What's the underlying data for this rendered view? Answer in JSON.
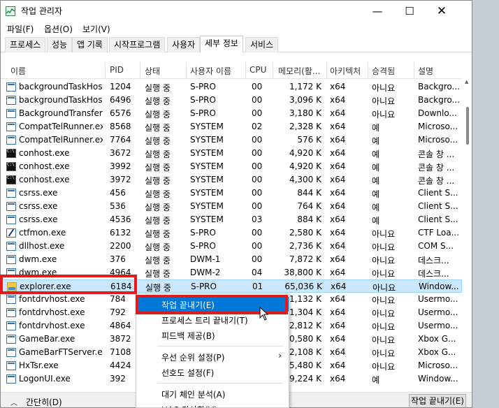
{
  "window": {
    "title": "작업 관리자"
  },
  "menu": [
    "파일(F)",
    "옵션(O)",
    "보기(V)"
  ],
  "tabs": [
    "프로세스",
    "성능",
    "앱 기록",
    "시작프로그램",
    "사용자",
    "세부 정보",
    "서비스"
  ],
  "active_tab": "세부 정보",
  "columns": [
    "이름",
    "PID",
    "상태",
    "사용자 이름",
    "CPU",
    "메모리(활...",
    "아키텍처",
    "승격됨",
    "설명"
  ],
  "rows": [
    {
      "icon": "app",
      "name": "backgroundTaskHos...",
      "pid": "1204",
      "status": "실행 중",
      "user": "S-PRO",
      "cpu": "00",
      "mem": "1,172 K",
      "arch": "x64",
      "elev": "아니요",
      "desc": "Backgro..."
    },
    {
      "icon": "app",
      "name": "backgroundTaskHos...",
      "pid": "6496",
      "status": "실행 중",
      "user": "S-PRO",
      "cpu": "00",
      "mem": "3,096 K",
      "arch": "x64",
      "elev": "아니요",
      "desc": "Backgro..."
    },
    {
      "icon": "app",
      "name": "BackgroundTransfer...",
      "pid": "6576",
      "status": "실행 중",
      "user": "S-PRO",
      "cpu": "00",
      "mem": "3,180 K",
      "arch": "x64",
      "elev": "아니요",
      "desc": "Downlo..."
    },
    {
      "icon": "app",
      "name": "CompatTelRunner.exe",
      "pid": "8568",
      "status": "실행 중",
      "user": "SYSTEM",
      "cpu": "02",
      "mem": "2,328 K",
      "arch": "x64",
      "elev": "예",
      "desc": "Microso..."
    },
    {
      "icon": "app",
      "name": "CompatTelRunner.exe",
      "pid": "7764",
      "status": "실행 중",
      "user": "SYSTEM",
      "cpu": "00",
      "mem": "576 K",
      "arch": "x64",
      "elev": "예",
      "desc": "Microso..."
    },
    {
      "icon": "con",
      "name": "conhost.exe",
      "pid": "3672",
      "status": "실행 중",
      "user": "SYSTEM",
      "cpu": "00",
      "mem": "4,920 K",
      "arch": "x64",
      "elev": "예",
      "desc": "콘솔 창 ..."
    },
    {
      "icon": "con",
      "name": "conhost.exe",
      "pid": "3992",
      "status": "실행 중",
      "user": "SYSTEM",
      "cpu": "00",
      "mem": "4,920 K",
      "arch": "x64",
      "elev": "예",
      "desc": "콘솔 창 ..."
    },
    {
      "icon": "con",
      "name": "conhost.exe",
      "pid": "3972",
      "status": "실행 중",
      "user": "SYSTEM",
      "cpu": "00",
      "mem": "4,300 K",
      "arch": "x64",
      "elev": "예",
      "desc": "콘솔 창 ..."
    },
    {
      "icon": "app",
      "name": "csrss.exe",
      "pid": "456",
      "status": "실행 중",
      "user": "SYSTEM",
      "cpu": "00",
      "mem": "844 K",
      "arch": "x64",
      "elev": "예",
      "desc": "Client S..."
    },
    {
      "icon": "app",
      "name": "csrss.exe",
      "pid": "536",
      "status": "실행 중",
      "user": "SYSTEM",
      "cpu": "00",
      "mem": "764 K",
      "arch": "x64",
      "elev": "예",
      "desc": "Client S..."
    },
    {
      "icon": "app",
      "name": "csrss.exe",
      "pid": "4536",
      "status": "실행 중",
      "user": "SYSTEM",
      "cpu": "03",
      "mem": "884 K",
      "arch": "x64",
      "elev": "예",
      "desc": "Client S..."
    },
    {
      "icon": "pen",
      "name": "ctfmon.exe",
      "pid": "6132",
      "status": "실행 중",
      "user": "S-PRO",
      "cpu": "00",
      "mem": "2,580 K",
      "arch": "x64",
      "elev": "아니요",
      "desc": "CTF Loa..."
    },
    {
      "icon": "app",
      "name": "dllhost.exe",
      "pid": "2200",
      "status": "실행 중",
      "user": "S-PRO",
      "cpu": "00",
      "mem": "2,736 K",
      "arch": "x64",
      "elev": "아니요",
      "desc": "COM S..."
    },
    {
      "icon": "app",
      "name": "dwm.exe",
      "pid": "376",
      "status": "실행 중",
      "user": "DWM-1",
      "cpu": "00",
      "mem": "7,872 K",
      "arch": "x64",
      "elev": "아니요",
      "desc": "데스크..."
    },
    {
      "icon": "app",
      "name": "dwm.exe",
      "pid": "4964",
      "status": "실행 중",
      "user": "DWM-2",
      "cpu": "04",
      "mem": "38,800 K",
      "arch": "x64",
      "elev": "아니요",
      "desc": "데스크..."
    },
    {
      "icon": "explorer",
      "name": "explorer.exe",
      "pid": "6184",
      "status": "실행 중",
      "user": "S-PRO",
      "cpu": "01",
      "mem": "65,036 K",
      "arch": "x64",
      "elev": "아니요",
      "desc": "Window...",
      "selected": true
    },
    {
      "icon": "app",
      "name": "fontdrvhost.exe",
      "pid": "784",
      "status": "",
      "user": "",
      "cpu": "",
      "mem": "1,132 K",
      "arch": "x64",
      "elev": "아니요",
      "desc": "Usermo..."
    },
    {
      "icon": "app",
      "name": "fontdrvhost.exe",
      "pid": "792",
      "status": "",
      "user": "",
      "cpu": "",
      "mem": "1,304 K",
      "arch": "x64",
      "elev": "아니요",
      "desc": "Usermo..."
    },
    {
      "icon": "app",
      "name": "fontdrvhost.exe",
      "pid": "4864",
      "status": "",
      "user": "",
      "cpu": "",
      "mem": "2,812 K",
      "arch": "x64",
      "elev": "아니요",
      "desc": "Usermo..."
    },
    {
      "icon": "app",
      "name": "GameBar.exe",
      "pid": "3872",
      "status": "",
      "user": "",
      "cpu": "",
      "mem": "0,580 K",
      "arch": "x64",
      "elev": "아니요",
      "desc": "Xbox G..."
    },
    {
      "icon": "app",
      "name": "GameBarFTServer.exe",
      "pid": "7108",
      "status": "",
      "user": "",
      "cpu": "",
      "mem": "2,108 K",
      "arch": "x64",
      "elev": "아니요",
      "desc": "Xbox G..."
    },
    {
      "icon": "app",
      "name": "HxTsr.exe",
      "pid": "4424",
      "status": "",
      "user": "",
      "cpu": "",
      "mem": "5,480 K",
      "arch": "x64",
      "elev": "아니요",
      "desc": "Microso..."
    },
    {
      "icon": "app",
      "name": "LogonUI.exe",
      "pid": "392",
      "status": "",
      "user": "",
      "cpu": "",
      "mem": "9,224 K",
      "arch": "x64",
      "elev": "예",
      "desc": "Window..."
    }
  ],
  "context_menu": [
    {
      "label": "작업 끝내기(E)",
      "highlighted": true
    },
    {
      "label": "프로세스 트리 끝내기(T)"
    },
    {
      "label": "피드백 제공(B)"
    },
    {
      "separator": true
    },
    {
      "label": "우선 순위 설정(P)",
      "submenu": true
    },
    {
      "label": "선호도 설정(F)"
    },
    {
      "separator": true
    },
    {
      "label": "대기 체인 분석(A)"
    },
    {
      "label": "UAC 가상화(V)"
    }
  ],
  "footer": {
    "collapse_label": "간단히(D)",
    "end_task_label": "작업 끝내기(E)"
  },
  "colors": {
    "accent": "#0078d7",
    "selection": "#cce8ff",
    "annotation": "#e01b1b"
  }
}
